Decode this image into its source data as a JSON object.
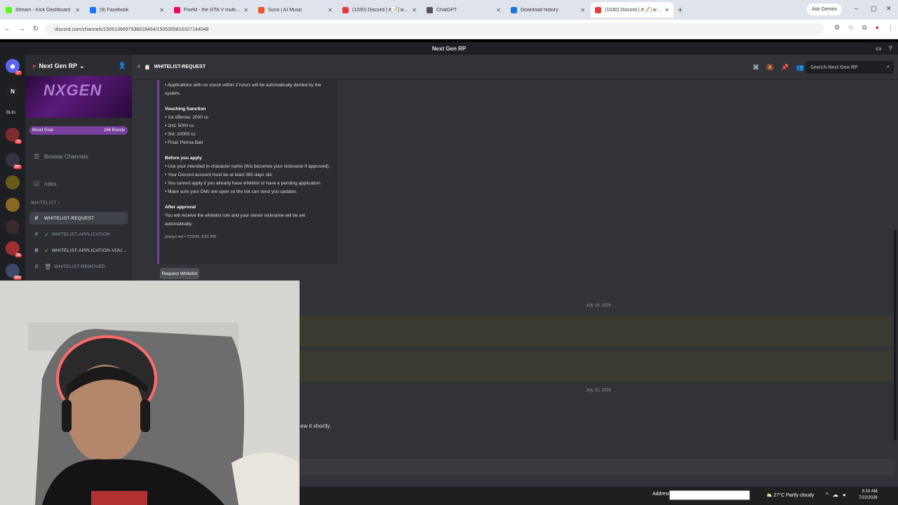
{
  "browser": {
    "tabs": [
      {
        "label": "Stream - Kick Dashboard",
        "color": "#53fc18"
      },
      {
        "label": "(9) Facebook",
        "color": "#1877f2"
      },
      {
        "label": "FiveM - the GTA V multiplayer",
        "color": "#f40552"
      },
      {
        "label": "Suno | AI Music",
        "color": "#e8562a"
      },
      {
        "label": "(1030) Discord | #📝│whitelis",
        "color": "#e23c3c"
      },
      {
        "label": "ChatGPT",
        "color": "#555555"
      },
      {
        "label": "Download history",
        "color": "#1a73e8"
      },
      {
        "label": "(1030) Discord | #📝│whitelis",
        "color": "#e23c3c"
      }
    ],
    "ask_gemini": "Ask Gemini",
    "url": "discord.com/channels/1505136697938018464/1505355810327144048"
  },
  "discord": {
    "window_title": "Next Gen RP",
    "server": {
      "name": "Next Gen RP",
      "banner_text": "NXGEN",
      "boost_label": "Boost Goal",
      "boost_count": "166 Boosts"
    },
    "sidebar": {
      "browse": "Browse Channels",
      "rules": "rules",
      "category": "WHITELIST",
      "channels": [
        {
          "label": "WHITELIST-REQUEST",
          "active": true
        },
        {
          "label": "WHITELIST-APPLICATION",
          "active": false
        },
        {
          "label": "WHITELIST-APPLICATION-VOU...",
          "active": false
        },
        {
          "label": "WHITELIST-REMOVED",
          "active": false
        }
      ]
    },
    "guild_badges": [
      "27",
      "33",
      "397",
      "60",
      "368"
    ],
    "guild_label": "BLtls",
    "channel_header": "WHITELIST-REQUEST",
    "search_placeholder": "Search Next Gen RP",
    "embed": {
      "intro": "• Applications with no vouch within 2 hours will be automatically denied by the system.",
      "vouching_title": "Vouching Sanction",
      "vouching": [
        "• 1st offense: 2000 cs",
        "• 2nd: 5000 cs",
        "• 3rd: 10000 cs",
        "• Final: Perma Ban"
      ],
      "before_title": "Before you apply",
      "before": [
        "• Use your intended in-character name (this becomes your nickname if approved).",
        "• Your Discord account must be at least 365 days old.",
        "• You cannot apply if you already have whitelist or have a pending application.",
        "• Make sure your DMs are open so the bot can send you updates."
      ],
      "after_title": "After approval",
      "after": "You will receive the whitelist role and your server nickname will be set automatically.",
      "footer": "pranyo.net • 7/12/26, 8:51 PM"
    },
    "request_button": "Request Whitelist",
    "date_1": "July 19, 2026",
    "date_2": "July 22, 2026",
    "trailing_text": "ew it shortly."
  },
  "taskbar": {
    "address_label": "Address",
    "weather": "27°C Partly cloudy",
    "time": "5:10 AM",
    "date": "7/22/2026"
  }
}
